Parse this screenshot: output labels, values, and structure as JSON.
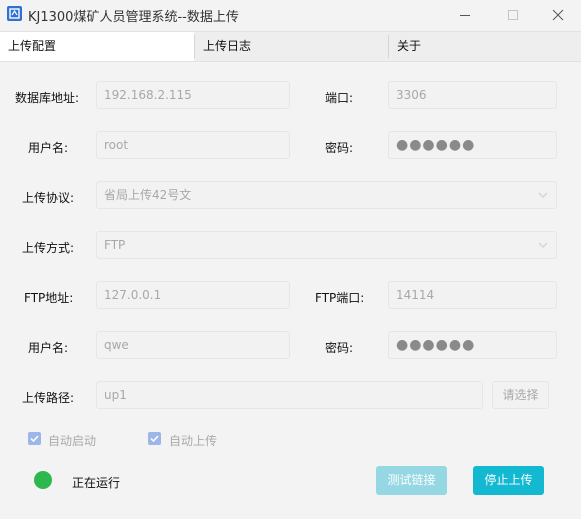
{
  "window": {
    "title": "KJ1300煤矿人员管理系统--数据上传"
  },
  "tabs": [
    {
      "label": "上传配置"
    },
    {
      "label": "上传日志"
    },
    {
      "label": "关于"
    }
  ],
  "form": {
    "db_address_label": "数据库地址:",
    "db_address_value": "192.168.2.115",
    "port_label": "端口:",
    "port_value": "3306",
    "username_label": "用户名:",
    "username_value": "root",
    "password_label": "密码:",
    "password_value": "●●●●●●",
    "protocol_label": "上传协议:",
    "protocol_value": "省局上传42号文",
    "method_label": "上传方式:",
    "method_value": "FTP",
    "ftp_address_label": "FTP地址:",
    "ftp_address_value": "127.0.0.1",
    "ftp_port_label": "FTP端口:",
    "ftp_port_value": "14114",
    "ftp_username_label": "用户名:",
    "ftp_username_value": "qwe",
    "ftp_password_label": "密码:",
    "ftp_password_value": "●●●●●●",
    "path_label": "上传路径:",
    "path_value": "up1",
    "choose_button": "请选择"
  },
  "options": {
    "auto_start_label": "自动启动",
    "auto_start_checked": true,
    "auto_upload_label": "自动上传",
    "auto_upload_checked": true
  },
  "status": {
    "text": "正在运行",
    "color": "#2db84d"
  },
  "buttons": {
    "test_link": "测试链接",
    "stop_upload": "停止上传"
  },
  "colors": {
    "accent": "#13b8d1",
    "accent_disabled": "#95d7e3",
    "checkbox": "#9cb6e8"
  }
}
